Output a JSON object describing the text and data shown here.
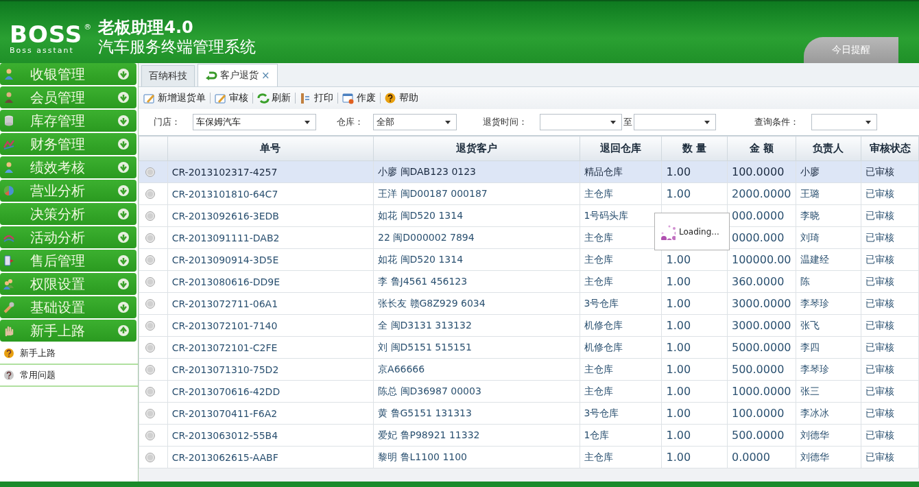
{
  "header": {
    "logo": "BOSS",
    "logo_mark": "®",
    "logo_sub": "Boss asstant",
    "product": "老板助理4.0",
    "subtitle": "汽车服务终端管理系统",
    "reminder_tab": "今日提醒"
  },
  "sidebar": {
    "items": [
      {
        "label": "收银管理",
        "expanded": false
      },
      {
        "label": "会员管理",
        "expanded": false
      },
      {
        "label": "库存管理",
        "expanded": false
      },
      {
        "label": "财务管理",
        "expanded": false
      },
      {
        "label": "绩效考核",
        "expanded": false
      },
      {
        "label": "营业分析",
        "expanded": false
      },
      {
        "label": "决策分析",
        "expanded": false
      },
      {
        "label": "活动分析",
        "expanded": false
      },
      {
        "label": "售后管理",
        "expanded": false
      },
      {
        "label": "权限设置",
        "expanded": false
      },
      {
        "label": "基础设置",
        "expanded": false
      },
      {
        "label": "新手上路",
        "expanded": true,
        "children": [
          {
            "label": "新手上路",
            "kind": "help"
          },
          {
            "label": "常用问题",
            "kind": "faq"
          }
        ]
      }
    ]
  },
  "tabs": [
    {
      "label": "百纳科技",
      "selected": false
    },
    {
      "label": "客户退货",
      "selected": true,
      "close": "×"
    }
  ],
  "toolbar": [
    {
      "label": "新增退货单",
      "kind": "new"
    },
    {
      "label": "审核",
      "kind": "audit"
    },
    {
      "label": "刷新",
      "kind": "refresh"
    },
    {
      "label": "打印",
      "kind": "print"
    },
    {
      "label": "作废",
      "kind": "void"
    },
    {
      "label": "帮助",
      "kind": "help"
    }
  ],
  "filters": {
    "store_label": "门店：",
    "store": "车保姆汽车",
    "warehouse_label": "仓库：",
    "warehouse": "全部",
    "time_label": "退货时间：",
    "to_label": "至",
    "query_label": "查询条件："
  },
  "table": {
    "columns": [
      "单号",
      "退货客户",
      "退回仓库",
      "数 量",
      "金 额",
      "负责人",
      "审核状态"
    ],
    "rows": [
      {
        "selected": true,
        "cells": [
          "CR-2013102317-4257",
          "小廖 闽DAB123 0123",
          "精品仓库",
          "1.00",
          "100.0000",
          "小廖",
          "已审核"
        ]
      },
      {
        "selected": false,
        "cells": [
          "CR-2013101810-64C7",
          "王洋 闽D00187 000187",
          "主仓库",
          "1.00",
          "2000.0000",
          "王璐",
          "已审核"
        ]
      },
      {
        "selected": false,
        "cells": [
          "CR-2013092616-3EDB",
          "如花 闽D520 1314",
          "1号码头库",
          "",
          "000.0000",
          "李晓",
          "已审核"
        ]
      },
      {
        "selected": false,
        "cells": [
          "CR-2013091111-DAB2",
          "22 闽D000002 7894",
          "主仓库",
          "",
          "0000.000",
          "刘琦",
          "已审核"
        ]
      },
      {
        "selected": false,
        "cells": [
          "CR-2013090914-3D5E",
          "如花 闽D520 1314",
          "主仓库",
          "1.00",
          "100000.00",
          "温建经",
          "已审核"
        ]
      },
      {
        "selected": false,
        "cells": [
          "CR-2013080616-DD9E",
          "李 鲁J4561 456123",
          "主仓库",
          "1.00",
          "360.0000",
          "陈",
          "已审核"
        ]
      },
      {
        "selected": false,
        "cells": [
          "CR-2013072711-06A1",
          "张长友 赣G8Z929 6034",
          "3号仓库",
          "1.00",
          "3000.0000",
          "李琴珍",
          "已审核"
        ]
      },
      {
        "selected": false,
        "cells": [
          "CR-2013072101-7140",
          "全 闽D3131 313132",
          "机修仓库",
          "1.00",
          "3000.0000",
          "张飞",
          "已审核"
        ]
      },
      {
        "selected": false,
        "cells": [
          "CR-2013072101-C2FE",
          "刘 闽D5151 515151",
          "机修仓库",
          "1.00",
          "5000.0000",
          "李四",
          "已审核"
        ]
      },
      {
        "selected": false,
        "cells": [
          "CR-2013071310-75D2",
          "京A66666",
          "主仓库",
          "1.00",
          "500.0000",
          "李琴珍",
          "已审核"
        ]
      },
      {
        "selected": false,
        "cells": [
          "CR-2013070616-42DD",
          "陈总 闽D36987 00003",
          "主仓库",
          "1.00",
          "1000.0000",
          "张三",
          "已审核"
        ]
      },
      {
        "selected": false,
        "cells": [
          "CR-2013070411-F6A2",
          "黄 鲁G5151 131313",
          "3号仓库",
          "1.00",
          "100.0000",
          "李冰冰",
          "已审核"
        ]
      },
      {
        "selected": false,
        "cells": [
          "CR-2013063012-55B4",
          "爱妃 鲁P98921 11332",
          "1仓库",
          "1.00",
          "500.0000",
          "刘德华",
          "已审核"
        ]
      },
      {
        "selected": false,
        "cells": [
          "CR-2013062615-AABF",
          "黎明 鲁L1100 1100",
          "主仓库",
          "1.00",
          "0.0000",
          "刘德华",
          "已审核"
        ]
      }
    ]
  },
  "loading": {
    "text": "Loading..."
  }
}
